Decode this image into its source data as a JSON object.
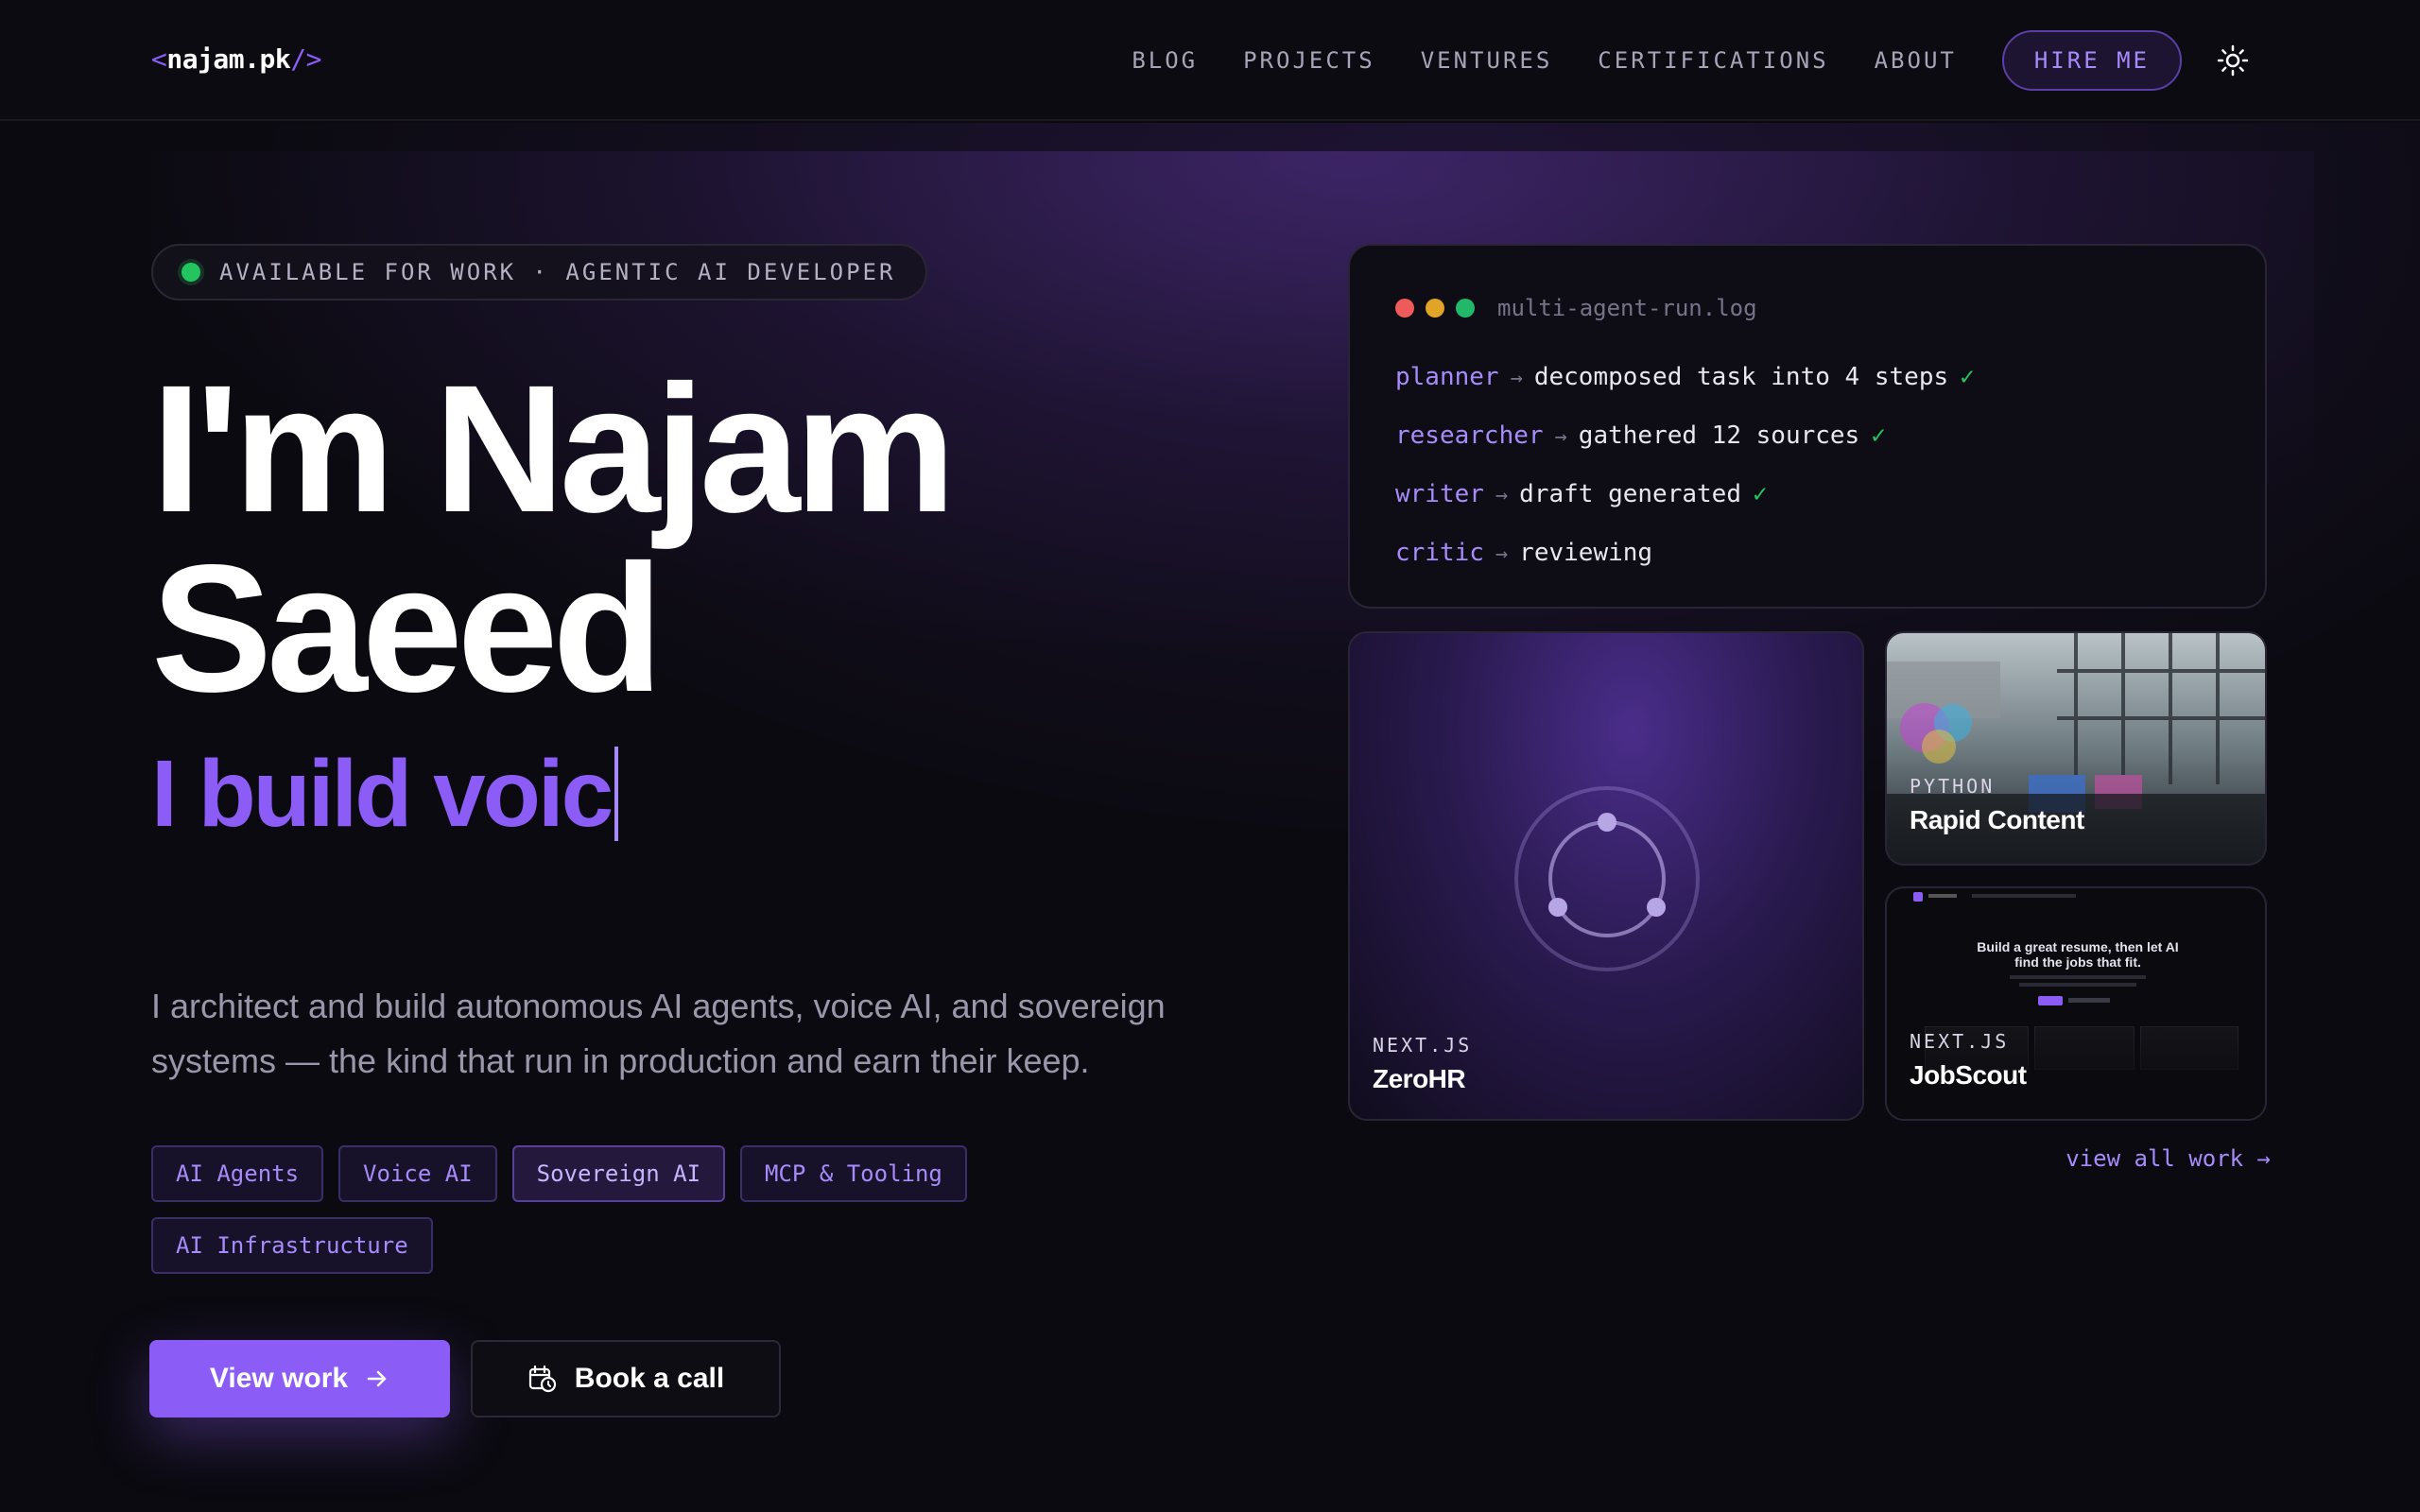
{
  "nav": {
    "logo_open": "<",
    "logo_text": "najam.pk",
    "logo_close": "/>",
    "links": [
      "BLOG",
      "PROJECTS",
      "VENTURES",
      "CERTIFICATIONS",
      "ABOUT"
    ],
    "hire_label": "HIRE ME",
    "theme_icon": "sun-icon"
  },
  "hero": {
    "badge": "AVAILABLE FOR WORK · AGENTIC AI DEVELOPER",
    "name_line1": "I'm Najam",
    "name_line2": "Saeed",
    "typed": "I build voic",
    "description": "I architect and build autonomous AI agents, voice AI, and sovereign systems — the kind that run in production and earn their keep.",
    "tags": [
      "AI Agents",
      "Voice AI",
      "Sovereign AI",
      "MCP & Tooling",
      "AI Infrastructure"
    ],
    "primary_button": "View work",
    "secondary_button": "Book a call"
  },
  "terminal": {
    "filename": "multi-agent-run.log",
    "lines": [
      {
        "agent": "planner",
        "text": "decomposed task into 4 steps",
        "check": "✓"
      },
      {
        "agent": "researcher",
        "text": "gathered 12 sources",
        "check": "✓"
      },
      {
        "agent": "writer",
        "text": "draft generated",
        "check": "✓"
      },
      {
        "agent": "critic",
        "text": "reviewing",
        "check": ""
      }
    ]
  },
  "projects": [
    {
      "stack": "NEXT.JS",
      "title": "ZeroHR"
    },
    {
      "stack": "PYTHON",
      "title": "Rapid Content"
    },
    {
      "stack": "NEXT.JS",
      "title": "JobScout"
    }
  ],
  "jobscout_preview": {
    "headline_1": "Build a great resume, then let AI",
    "headline_2": "find the jobs that fit."
  },
  "view_all": "view all work →",
  "colors": {
    "accent": "#8b5cf6",
    "accent_light": "#a78bfa",
    "status_green": "#22c55e",
    "background": "#0b0a10"
  }
}
